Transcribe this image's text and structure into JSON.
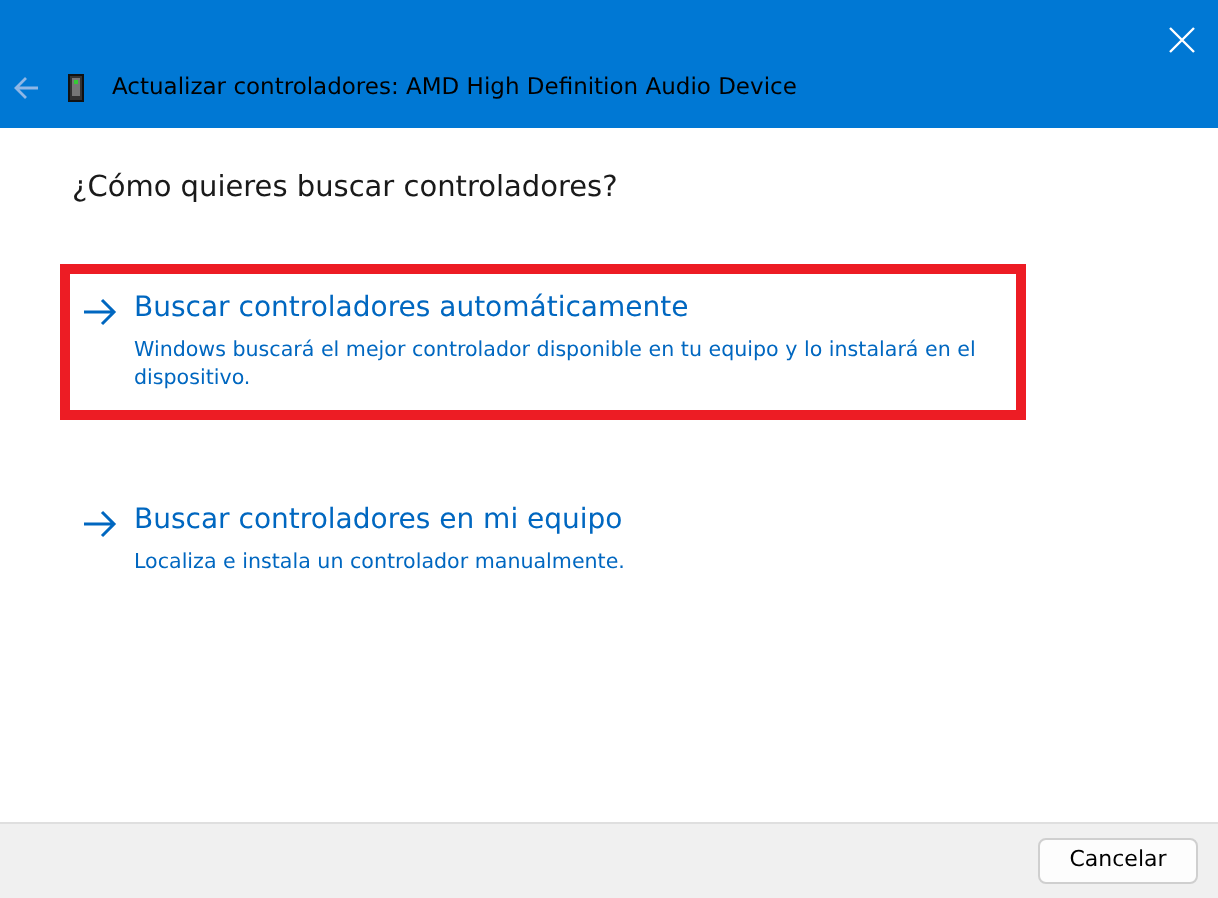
{
  "window": {
    "title": "Actualizar controladores: AMD High Definition Audio Device",
    "back_disabled": true
  },
  "question": "¿Cómo quieres buscar controladores?",
  "options": [
    {
      "title": "Buscar controladores automáticamente",
      "description": "Windows buscará el mejor controlador disponible en tu equipo y lo instalará en el dispositivo.",
      "highlighted": true
    },
    {
      "title": "Buscar controladores en mi equipo",
      "description": "Localiza e instala un controlador manualmente.",
      "highlighted": false
    }
  ],
  "buttons": [
    "Cancelar"
  ]
}
